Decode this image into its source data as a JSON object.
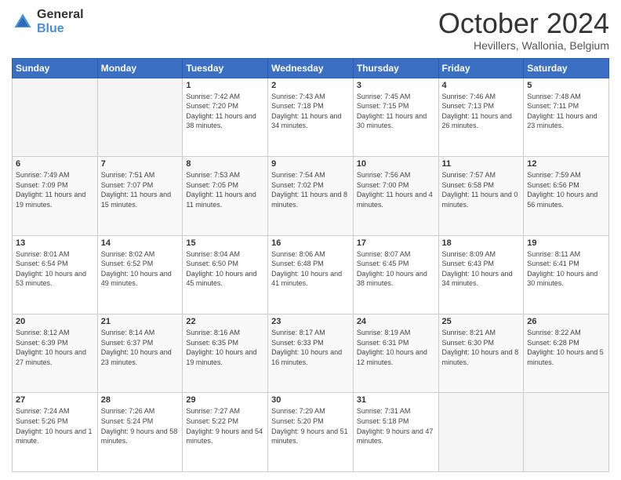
{
  "logo": {
    "line1": "General",
    "line2": "Blue"
  },
  "title": "October 2024",
  "subtitle": "Hevillers, Wallonia, Belgium",
  "weekdays": [
    "Sunday",
    "Monday",
    "Tuesday",
    "Wednesday",
    "Thursday",
    "Friday",
    "Saturday"
  ],
  "weeks": [
    [
      {
        "day": "",
        "info": ""
      },
      {
        "day": "",
        "info": ""
      },
      {
        "day": "1",
        "info": "Sunrise: 7:42 AM\nSunset: 7:20 PM\nDaylight: 11 hours and 38 minutes."
      },
      {
        "day": "2",
        "info": "Sunrise: 7:43 AM\nSunset: 7:18 PM\nDaylight: 11 hours and 34 minutes."
      },
      {
        "day": "3",
        "info": "Sunrise: 7:45 AM\nSunset: 7:15 PM\nDaylight: 11 hours and 30 minutes."
      },
      {
        "day": "4",
        "info": "Sunrise: 7:46 AM\nSunset: 7:13 PM\nDaylight: 11 hours and 26 minutes."
      },
      {
        "day": "5",
        "info": "Sunrise: 7:48 AM\nSunset: 7:11 PM\nDaylight: 11 hours and 23 minutes."
      }
    ],
    [
      {
        "day": "6",
        "info": "Sunrise: 7:49 AM\nSunset: 7:09 PM\nDaylight: 11 hours and 19 minutes."
      },
      {
        "day": "7",
        "info": "Sunrise: 7:51 AM\nSunset: 7:07 PM\nDaylight: 11 hours and 15 minutes."
      },
      {
        "day": "8",
        "info": "Sunrise: 7:53 AM\nSunset: 7:05 PM\nDaylight: 11 hours and 11 minutes."
      },
      {
        "day": "9",
        "info": "Sunrise: 7:54 AM\nSunset: 7:02 PM\nDaylight: 11 hours and 8 minutes."
      },
      {
        "day": "10",
        "info": "Sunrise: 7:56 AM\nSunset: 7:00 PM\nDaylight: 11 hours and 4 minutes."
      },
      {
        "day": "11",
        "info": "Sunrise: 7:57 AM\nSunset: 6:58 PM\nDaylight: 11 hours and 0 minutes."
      },
      {
        "day": "12",
        "info": "Sunrise: 7:59 AM\nSunset: 6:56 PM\nDaylight: 10 hours and 56 minutes."
      }
    ],
    [
      {
        "day": "13",
        "info": "Sunrise: 8:01 AM\nSunset: 6:54 PM\nDaylight: 10 hours and 53 minutes."
      },
      {
        "day": "14",
        "info": "Sunrise: 8:02 AM\nSunset: 6:52 PM\nDaylight: 10 hours and 49 minutes."
      },
      {
        "day": "15",
        "info": "Sunrise: 8:04 AM\nSunset: 6:50 PM\nDaylight: 10 hours and 45 minutes."
      },
      {
        "day": "16",
        "info": "Sunrise: 8:06 AM\nSunset: 6:48 PM\nDaylight: 10 hours and 41 minutes."
      },
      {
        "day": "17",
        "info": "Sunrise: 8:07 AM\nSunset: 6:45 PM\nDaylight: 10 hours and 38 minutes."
      },
      {
        "day": "18",
        "info": "Sunrise: 8:09 AM\nSunset: 6:43 PM\nDaylight: 10 hours and 34 minutes."
      },
      {
        "day": "19",
        "info": "Sunrise: 8:11 AM\nSunset: 6:41 PM\nDaylight: 10 hours and 30 minutes."
      }
    ],
    [
      {
        "day": "20",
        "info": "Sunrise: 8:12 AM\nSunset: 6:39 PM\nDaylight: 10 hours and 27 minutes."
      },
      {
        "day": "21",
        "info": "Sunrise: 8:14 AM\nSunset: 6:37 PM\nDaylight: 10 hours and 23 minutes."
      },
      {
        "day": "22",
        "info": "Sunrise: 8:16 AM\nSunset: 6:35 PM\nDaylight: 10 hours and 19 minutes."
      },
      {
        "day": "23",
        "info": "Sunrise: 8:17 AM\nSunset: 6:33 PM\nDaylight: 10 hours and 16 minutes."
      },
      {
        "day": "24",
        "info": "Sunrise: 8:19 AM\nSunset: 6:31 PM\nDaylight: 10 hours and 12 minutes."
      },
      {
        "day": "25",
        "info": "Sunrise: 8:21 AM\nSunset: 6:30 PM\nDaylight: 10 hours and 8 minutes."
      },
      {
        "day": "26",
        "info": "Sunrise: 8:22 AM\nSunset: 6:28 PM\nDaylight: 10 hours and 5 minutes."
      }
    ],
    [
      {
        "day": "27",
        "info": "Sunrise: 7:24 AM\nSunset: 5:26 PM\nDaylight: 10 hours and 1 minute."
      },
      {
        "day": "28",
        "info": "Sunrise: 7:26 AM\nSunset: 5:24 PM\nDaylight: 9 hours and 58 minutes."
      },
      {
        "day": "29",
        "info": "Sunrise: 7:27 AM\nSunset: 5:22 PM\nDaylight: 9 hours and 54 minutes."
      },
      {
        "day": "30",
        "info": "Sunrise: 7:29 AM\nSunset: 5:20 PM\nDaylight: 9 hours and 51 minutes."
      },
      {
        "day": "31",
        "info": "Sunrise: 7:31 AM\nSunset: 5:18 PM\nDaylight: 9 hours and 47 minutes."
      },
      {
        "day": "",
        "info": ""
      },
      {
        "day": "",
        "info": ""
      }
    ]
  ]
}
